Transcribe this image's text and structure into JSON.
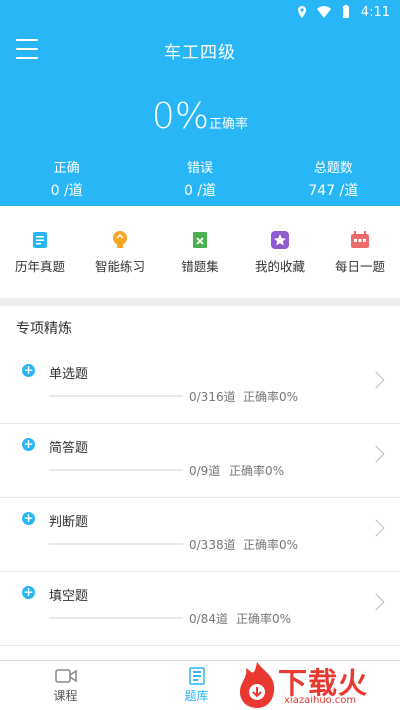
{
  "status": {
    "time": "4:11"
  },
  "header": {
    "title": "车工四级"
  },
  "summary": {
    "rate_value": "0%",
    "rate_label": "正确率",
    "stats": [
      {
        "label": "正确",
        "value": "0 /道"
      },
      {
        "label": "错误",
        "value": "0 /道"
      },
      {
        "label": "总题数",
        "value": "747 /道"
      }
    ]
  },
  "quick": [
    {
      "label": "历年真题",
      "icon": "document-icon",
      "color": "#29b6f6"
    },
    {
      "label": "智能练习",
      "icon": "lightbulb-icon",
      "color": "#f5a623"
    },
    {
      "label": "错题集",
      "icon": "wrong-book-icon",
      "color": "#4caf50"
    },
    {
      "label": "我的收藏",
      "icon": "star-icon",
      "color": "#8e5bd0"
    },
    {
      "label": "每日一题",
      "icon": "calendar-icon",
      "color": "#ef6c6c"
    }
  ],
  "section": {
    "title": "专项精炼"
  },
  "items": [
    {
      "name": "单选题",
      "count": "0/316道",
      "rate": "正确率0%",
      "progress": 0
    },
    {
      "name": "简答题",
      "count": "0/9道",
      "rate": "正确率0%",
      "progress": 0
    },
    {
      "name": "判断题",
      "count": "0/338道",
      "rate": "正确率0%",
      "progress": 0
    },
    {
      "name": "填空题",
      "count": "0/84道",
      "rate": "正确率0%",
      "progress": 0
    }
  ],
  "nav": [
    {
      "label": "课程",
      "active": false
    },
    {
      "label": "题库",
      "active": true
    }
  ],
  "watermark": {
    "text": "下载火",
    "sub": "xiazaihuo.com"
  },
  "colors": {
    "primary": "#29b6f6",
    "accent": "#e8382f"
  }
}
